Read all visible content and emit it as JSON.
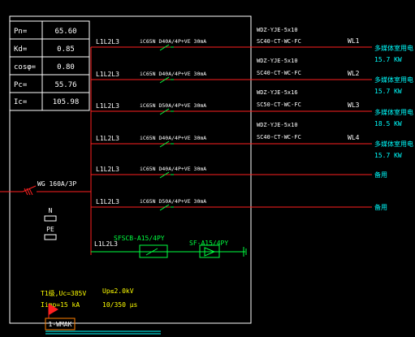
{
  "params": [
    {
      "label": "Pn=",
      "value": "65.60"
    },
    {
      "label": "Kd=",
      "value": "0.85"
    },
    {
      "label": "cosφ=",
      "value": "0.80"
    },
    {
      "label": "Pc=",
      "value": "55.76"
    },
    {
      "label": "Ic=",
      "value": "105.98"
    }
  ],
  "main_switch": "WG 160A/3P",
  "n_label": "N",
  "pe_label": "PE",
  "circuits": [
    {
      "phases": "L1L2L3",
      "breaker": "iC65N D40A/4P+VE 30mA",
      "cable": "WDZ-YJE-5x10",
      "conduit": "SC40-CT-WC-FC",
      "id": "WL1",
      "load_name": "多媒体室用电",
      "load_power": "15.7 KW"
    },
    {
      "phases": "L1L2L3",
      "breaker": "iC65N D40A/4P+VE 30mA",
      "cable": "WDZ-YJE-5x10",
      "conduit": "SC40-CT-WC-FC",
      "id": "WL2",
      "load_name": "多媒体室用电",
      "load_power": "15.7 KW"
    },
    {
      "phases": "L1L2L3",
      "breaker": "iC65N D50A/4P+VE 30mA",
      "cable": "WDZ-YJE-5x16",
      "conduit": "SC50-CT-WC-FC",
      "id": "WL3",
      "load_name": "多媒体室用电",
      "load_power": "18.5 KW"
    },
    {
      "phases": "L1L2L3",
      "breaker": "iC65N D40A/4P+VE 30mA",
      "cable": "WDZ-YJE-5x10",
      "conduit": "SC40-CT-WC-FC",
      "id": "WL4",
      "load_name": "多媒体室用电",
      "load_power": "15.7 KW"
    },
    {
      "phases": "L1L2L3",
      "breaker": "iC65N D40A/4P+VE 30mA",
      "cable": "",
      "conduit": "",
      "id": "",
      "load_name": "备用",
      "load_power": ""
    },
    {
      "phases": "L1L2L3",
      "breaker": "iC65N D50A/4P+VE 30mA",
      "cable": "",
      "conduit": "",
      "id": "",
      "load_name": "备用",
      "load_power": ""
    }
  ],
  "spd": {
    "phases": "L1L2L3",
    "sfscb": "SFSCB-A15/4PY",
    "sf": "SF-A15/4PY",
    "spec1": "T1级,Uc=385V",
    "spec2": "Iimp=15 kA",
    "spec3": "Up≤2.0kV",
    "spec4": "10/350 μs"
  },
  "panel_tag": "1-WMAK",
  "colors": {
    "line": "#ff2020",
    "frame": "#ffffff",
    "label": "#ffffff",
    "load": "#00ffff",
    "spd": "#00ff40",
    "spec": "#ffff00",
    "tag": "#ff8000"
  }
}
